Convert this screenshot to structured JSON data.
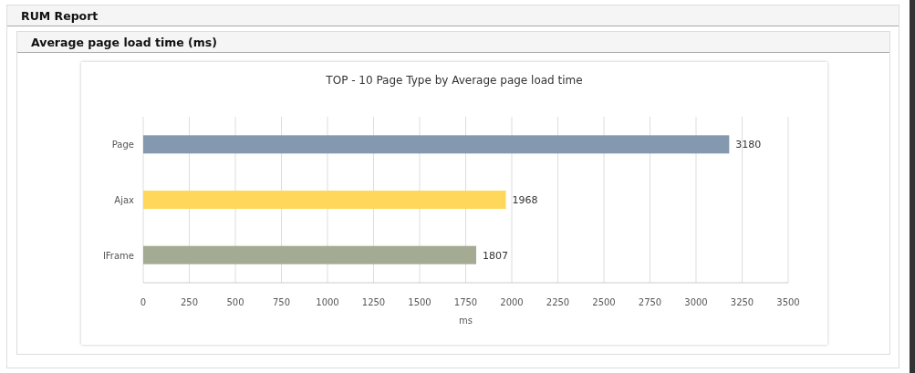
{
  "report": {
    "title": "RUM Report"
  },
  "panel": {
    "title": "Average page load time (ms)",
    "chart_data": {
      "type": "bar",
      "orientation": "horizontal",
      "title": "TOP - 10 Page Type by Average page load time",
      "xlabel": "ms",
      "categories": [
        "Page",
        "Ajax",
        "IFrame"
      ],
      "values": [
        3180,
        1968,
        1807
      ],
      "grid": true,
      "colors": [
        "#8499b0",
        "#ffd75a",
        "#a4ab93"
      ],
      "xlim": [
        0,
        3500
      ],
      "xticks": [
        0,
        250,
        500,
        750,
        1000,
        1250,
        1500,
        1750,
        2000,
        2250,
        2500,
        2750,
        3000,
        3250,
        3500
      ],
      "data_labels": true
    }
  }
}
